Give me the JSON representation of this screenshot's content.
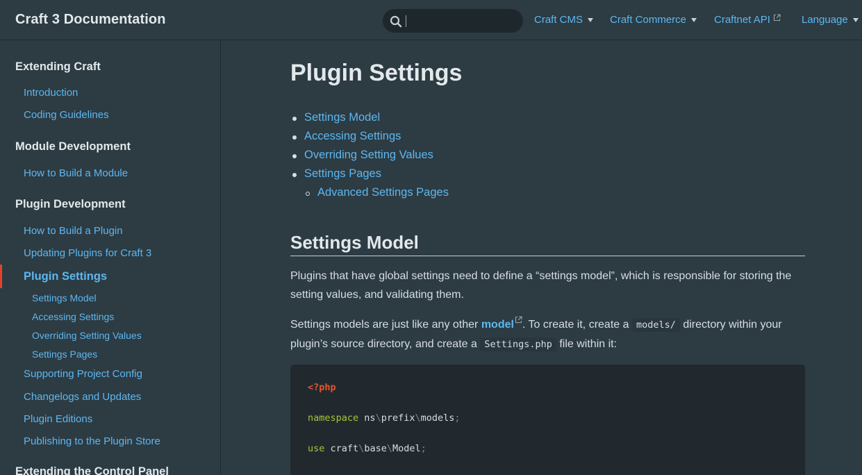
{
  "header": {
    "site_title": "Craft 3 Documentation",
    "search": {
      "placeholder": "",
      "value": ""
    },
    "nav": [
      {
        "label": "Craft CMS",
        "icon": "chevron-down-icon"
      },
      {
        "label": "Craft Commerce",
        "icon": "chevron-down-icon"
      },
      {
        "label": "Craftnet API",
        "icon": "external-link-icon"
      },
      {
        "label": "Language",
        "icon": "chevron-down-icon"
      }
    ]
  },
  "sidebar": {
    "groups": [
      {
        "title": "Extending Craft",
        "items": [
          "Introduction",
          "Coding Guidelines"
        ]
      },
      {
        "title": "Module Development",
        "items": [
          "How to Build a Module"
        ]
      },
      {
        "title": "Plugin Development",
        "items": [
          "How to Build a Plugin",
          "Updating Plugins for Craft 3"
        ]
      }
    ],
    "active": "Plugin Settings",
    "active_subitems": [
      "Settings Model",
      "Accessing Settings",
      "Overriding Setting Values",
      "Settings Pages"
    ],
    "more_items": [
      "Supporting Project Config",
      "Changelogs and Updates",
      "Plugin Editions",
      "Publishing to the Plugin Store"
    ],
    "next_group": "Extending the Control Panel"
  },
  "main": {
    "title": "Plugin Settings",
    "toc": [
      "Settings Model",
      "Accessing Settings",
      "Overriding Setting Values",
      "Settings Pages"
    ],
    "toc_sub": [
      "Advanced Settings Pages"
    ],
    "section_title": "Settings Model",
    "para1": "Plugins that have global settings need to define a “settings model”, which is responsible for storing the setting values, and validating them.",
    "para2": {
      "t1": "Settings models are just like any other ",
      "link": "model",
      "t2": ". To create it, create a ",
      "code1": "models/",
      "t3": " directory within your plugin’s source directory, and create a ",
      "code2": "Settings.php",
      "t4": " file within it:"
    },
    "code": {
      "line1": "<?php",
      "ns_kw": "namespace",
      "ns_parts": [
        "ns",
        "prefix",
        "models"
      ],
      "use_kw": "use",
      "use_parts": [
        "craft",
        "base",
        "Model"
      ],
      "sep": "\\",
      "semi": ";"
    }
  },
  "colors": {
    "background": "#2d3b43",
    "link": "#5cb8f0",
    "active_marker": "#e5422b",
    "code_bg": "#22292e",
    "php_tag": "#e5542b",
    "keyword": "#a4c639"
  }
}
